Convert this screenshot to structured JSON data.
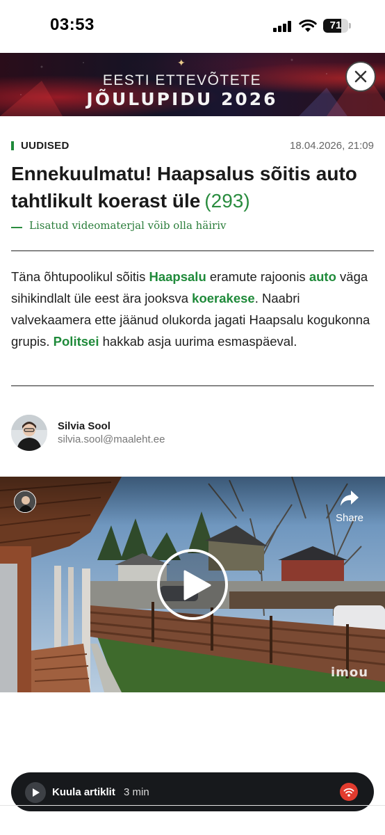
{
  "status_bar": {
    "time": "03:53",
    "battery_percent": 71,
    "battery_label": "71"
  },
  "banner": {
    "line1": "EESTI ETTEVÕTETE",
    "line2": "JÕULUPIDU 2026",
    "close_icon": "close-icon"
  },
  "article": {
    "category": "UUDISED",
    "date": "18.04.2026, 21:09",
    "headline": "Ennekuulmatu! Haapsalus sõitis auto tahtlikult koerast üle",
    "comment_count": "(293)",
    "warning": "Lisatud videomaterjal võib olla häiriv",
    "lead": [
      {
        "text": "Täna õhtupoolikul sõitis ",
        "kw": false
      },
      {
        "text": "Haapsalu",
        "kw": true
      },
      {
        "text": " eramute rajoonis ",
        "kw": false
      },
      {
        "text": "auto",
        "kw": true
      },
      {
        "text": " väga sihikindlalt üle eest ära jooksva ",
        "kw": false
      },
      {
        "text": "koerakese",
        "kw": true
      },
      {
        "text": ". Naabri valvekaamera ette jäänud olukorda jagati Haapsalu kogukonna grupis. ",
        "kw": false
      },
      {
        "text": "Politsei",
        "kw": true
      },
      {
        "text": " hakkab asja uurima esmaspäeval.",
        "kw": false
      }
    ]
  },
  "author": {
    "name": "Silvia Sool",
    "email": "silvia.sool@maaleht.ee"
  },
  "video": {
    "share_label": "Share",
    "watermark": "imou",
    "play_icon": "play-icon",
    "share_icon": "share-icon"
  },
  "audio_player": {
    "label": "Kuula artiklit",
    "duration": "3 min"
  },
  "colors": {
    "accent_green": "#1f8a3a",
    "audio_bar": "#17191c",
    "brand_red": "#e23b2e"
  }
}
